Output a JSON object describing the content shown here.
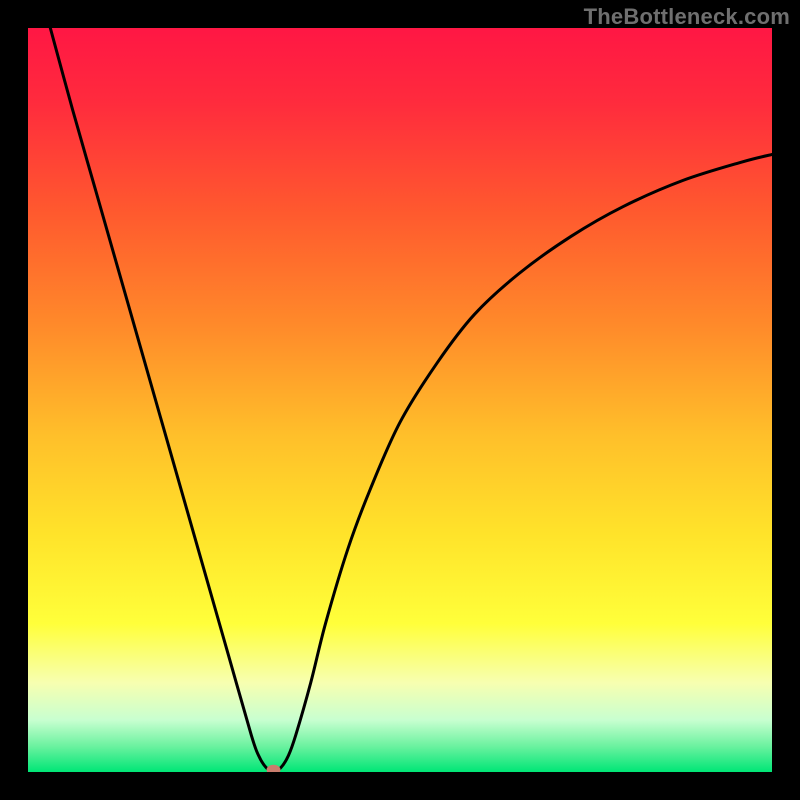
{
  "watermark": "TheBottleneck.com",
  "chart_data": {
    "type": "line",
    "title": "",
    "xlabel": "",
    "ylabel": "",
    "xlim": [
      0,
      100
    ],
    "ylim": [
      0,
      100
    ],
    "grid": false,
    "legend": false,
    "gradient_stops": [
      {
        "offset": 0.0,
        "color": "#ff1744"
      },
      {
        "offset": 0.1,
        "color": "#ff2b3d"
      },
      {
        "offset": 0.25,
        "color": "#ff5a2e"
      },
      {
        "offset": 0.4,
        "color": "#ff8a2a"
      },
      {
        "offset": 0.55,
        "color": "#ffc02a"
      },
      {
        "offset": 0.68,
        "color": "#ffe32a"
      },
      {
        "offset": 0.8,
        "color": "#ffff3a"
      },
      {
        "offset": 0.88,
        "color": "#f7ffb0"
      },
      {
        "offset": 0.93,
        "color": "#c8ffd0"
      },
      {
        "offset": 0.965,
        "color": "#6cf2a0"
      },
      {
        "offset": 1.0,
        "color": "#00e676"
      }
    ],
    "series": [
      {
        "name": "bottleneck-curve",
        "x": [
          3,
          6,
          9,
          12,
          15,
          18,
          21,
          24,
          27,
          30,
          31,
          32,
          33,
          34,
          35,
          36,
          38,
          40,
          43,
          46,
          50,
          55,
          60,
          66,
          73,
          80,
          88,
          96,
          100
        ],
        "y": [
          100,
          89,
          78.5,
          68,
          57.5,
          47,
          36.5,
          26,
          15.5,
          5,
          2.2,
          0.6,
          0.0,
          0.6,
          2.2,
          5.0,
          12,
          20,
          30,
          38,
          47,
          55,
          61.5,
          67,
          72,
          76,
          79.5,
          82,
          83
        ],
        "stroke": "#000000",
        "stroke_width": 3
      }
    ],
    "marker": {
      "x": 33,
      "y": 0.3,
      "rx": 7,
      "ry": 5,
      "fill": "#c97d6d"
    }
  }
}
